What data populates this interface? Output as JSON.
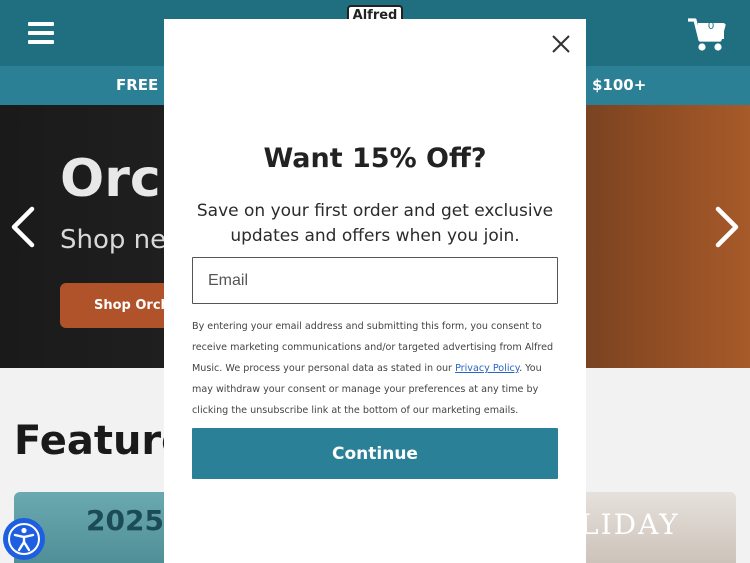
{
  "header": {
    "logo_text": "Alfred",
    "cart_count": "0"
  },
  "promo": {
    "left_text": "FREE S",
    "right_text": "$100+"
  },
  "hero": {
    "title": "Orc",
    "subtitle": "Shop new",
    "button_label": "Shop Orches"
  },
  "featured": {
    "title": "Feature",
    "card_left_year": "2025",
    "card_right_text": "LIDAY"
  },
  "modal": {
    "title": "Want 15% Off?",
    "subtitle": "Save on your first order and get exclusive updates and offers when you join.",
    "email_placeholder": "Email",
    "consent_before": "By entering your email address and submitting this form, you consent to receive marketing communications and/or targeted advertising from Alfred Music. We process your personal data as stated in our ",
    "consent_link": "Privacy Policy",
    "consent_after": ". You may withdraw your consent or manage your preferences at any time by clicking the unsubscribe link at the bottom of our marketing emails.",
    "continue_label": "Continue"
  },
  "colors": {
    "header_bg": "#1f6f80",
    "promo_bg": "#2c8096",
    "button_accent": "#2a8096",
    "hero_button": "#b0532a",
    "accessibility": "#1d5fe0"
  },
  "icons": {
    "menu": "hamburger-menu-icon",
    "cart": "shopping-cart-icon",
    "close": "close-icon",
    "prev": "chevron-left-icon",
    "next": "chevron-right-icon",
    "accessibility": "accessibility-icon"
  }
}
